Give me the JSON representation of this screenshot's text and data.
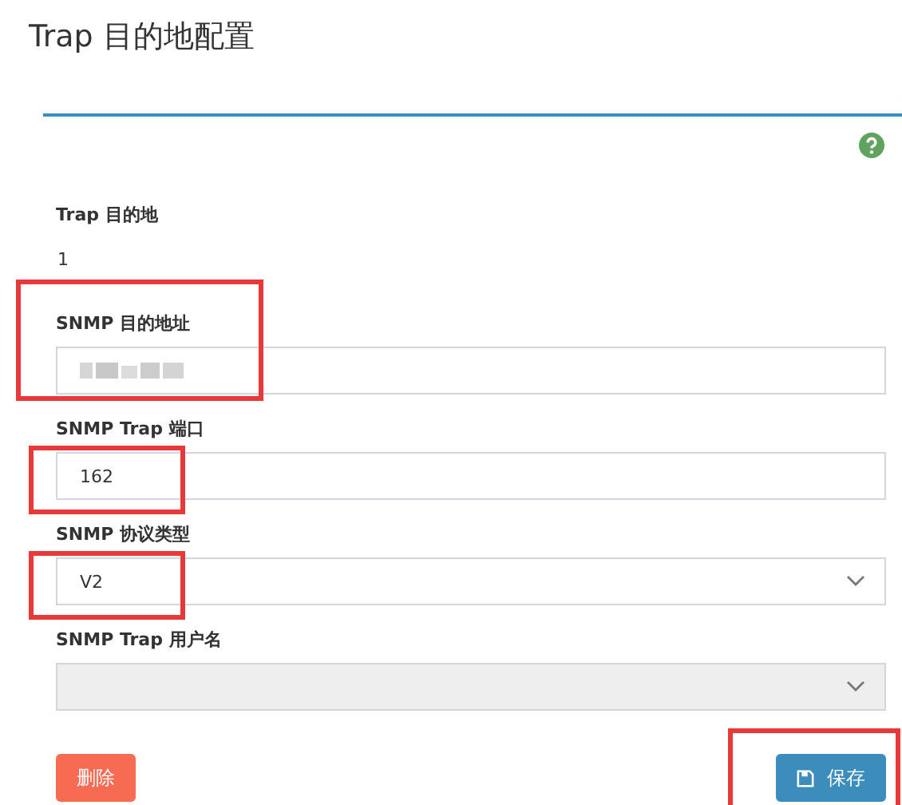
{
  "title": "Trap 目的地配置",
  "destination": {
    "label": "Trap 目的地",
    "value": "1"
  },
  "fields": [
    {
      "kind": "text",
      "label": "SNMP 目的地址",
      "redacted": true,
      "highlight": true,
      "disabled": false
    },
    {
      "kind": "text",
      "label": "SNMP Trap 端口",
      "value": "162",
      "highlight": true,
      "disabled": false
    },
    {
      "kind": "select",
      "label": "SNMP 协议类型",
      "value": "V2",
      "highlight": true,
      "disabled": false
    },
    {
      "kind": "select",
      "label": "SNMP Trap 用户名",
      "highlight": false,
      "disabled": true
    }
  ],
  "buttons": [
    {
      "kind": "delete",
      "label": "删除",
      "highlight": false
    },
    {
      "kind": "save",
      "label": "保存",
      "highlight": true
    }
  ]
}
